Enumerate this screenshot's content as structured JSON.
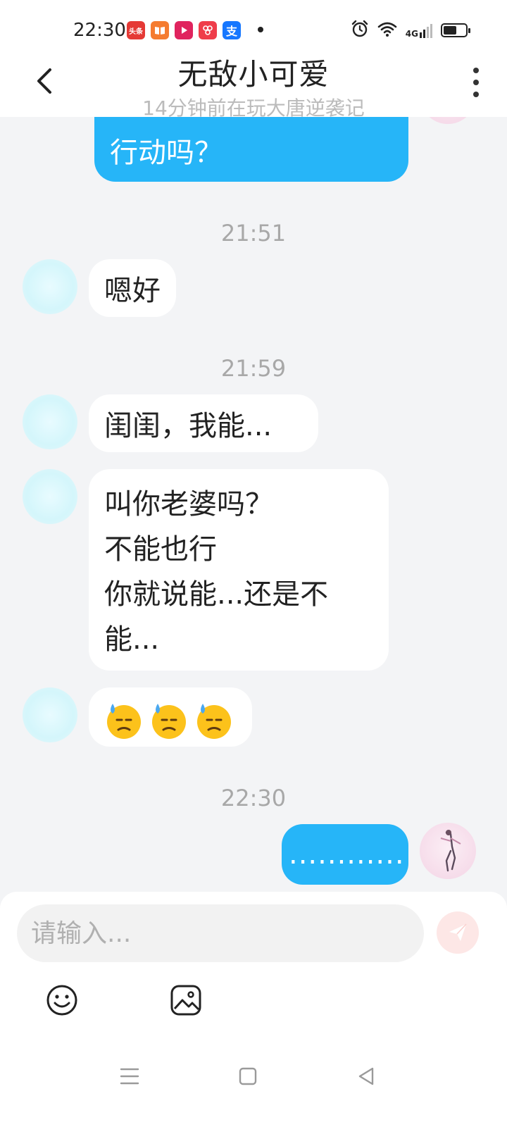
{
  "status_bar": {
    "time": "22:30",
    "app_icons": [
      {
        "name": "toutiao-app-icon",
        "label": "头条",
        "color": "#e53935"
      },
      {
        "name": "reader-app-icon",
        "label": "",
        "color": "#f57c30"
      },
      {
        "name": "video-app-icon",
        "label": "",
        "color": "#e0245e"
      },
      {
        "name": "pinduoduo-app-icon",
        "label": "",
        "color": "#ef3d4a"
      },
      {
        "name": "alipay-app-icon",
        "label": "支",
        "color": "#1677ff"
      }
    ],
    "network_label": "4G"
  },
  "header": {
    "title": "无敌小可爱",
    "subtitle": "14分钟前在玩大唐逆袭记"
  },
  "messages": {
    "m0": "行动吗？",
    "ts1": "21:51",
    "m1": "嗯好",
    "ts2": "21:59",
    "m2": "闺闺，我能...",
    "m3_l1": "叫你老婆吗？",
    "m3_l2": "不能也行",
    "m3_l3": "你就说能...还是不",
    "m3_l4": "能...",
    "m4_emoji": "downcast-face-with-sweat",
    "ts3": "22:30",
    "m5": "............"
  },
  "input": {
    "placeholder": "请输入..."
  },
  "colors": {
    "my_bubble": "#26b5f8",
    "their_bubble": "#ffffff",
    "background": "#f3f4f6",
    "send_button": "#fde7e6"
  }
}
